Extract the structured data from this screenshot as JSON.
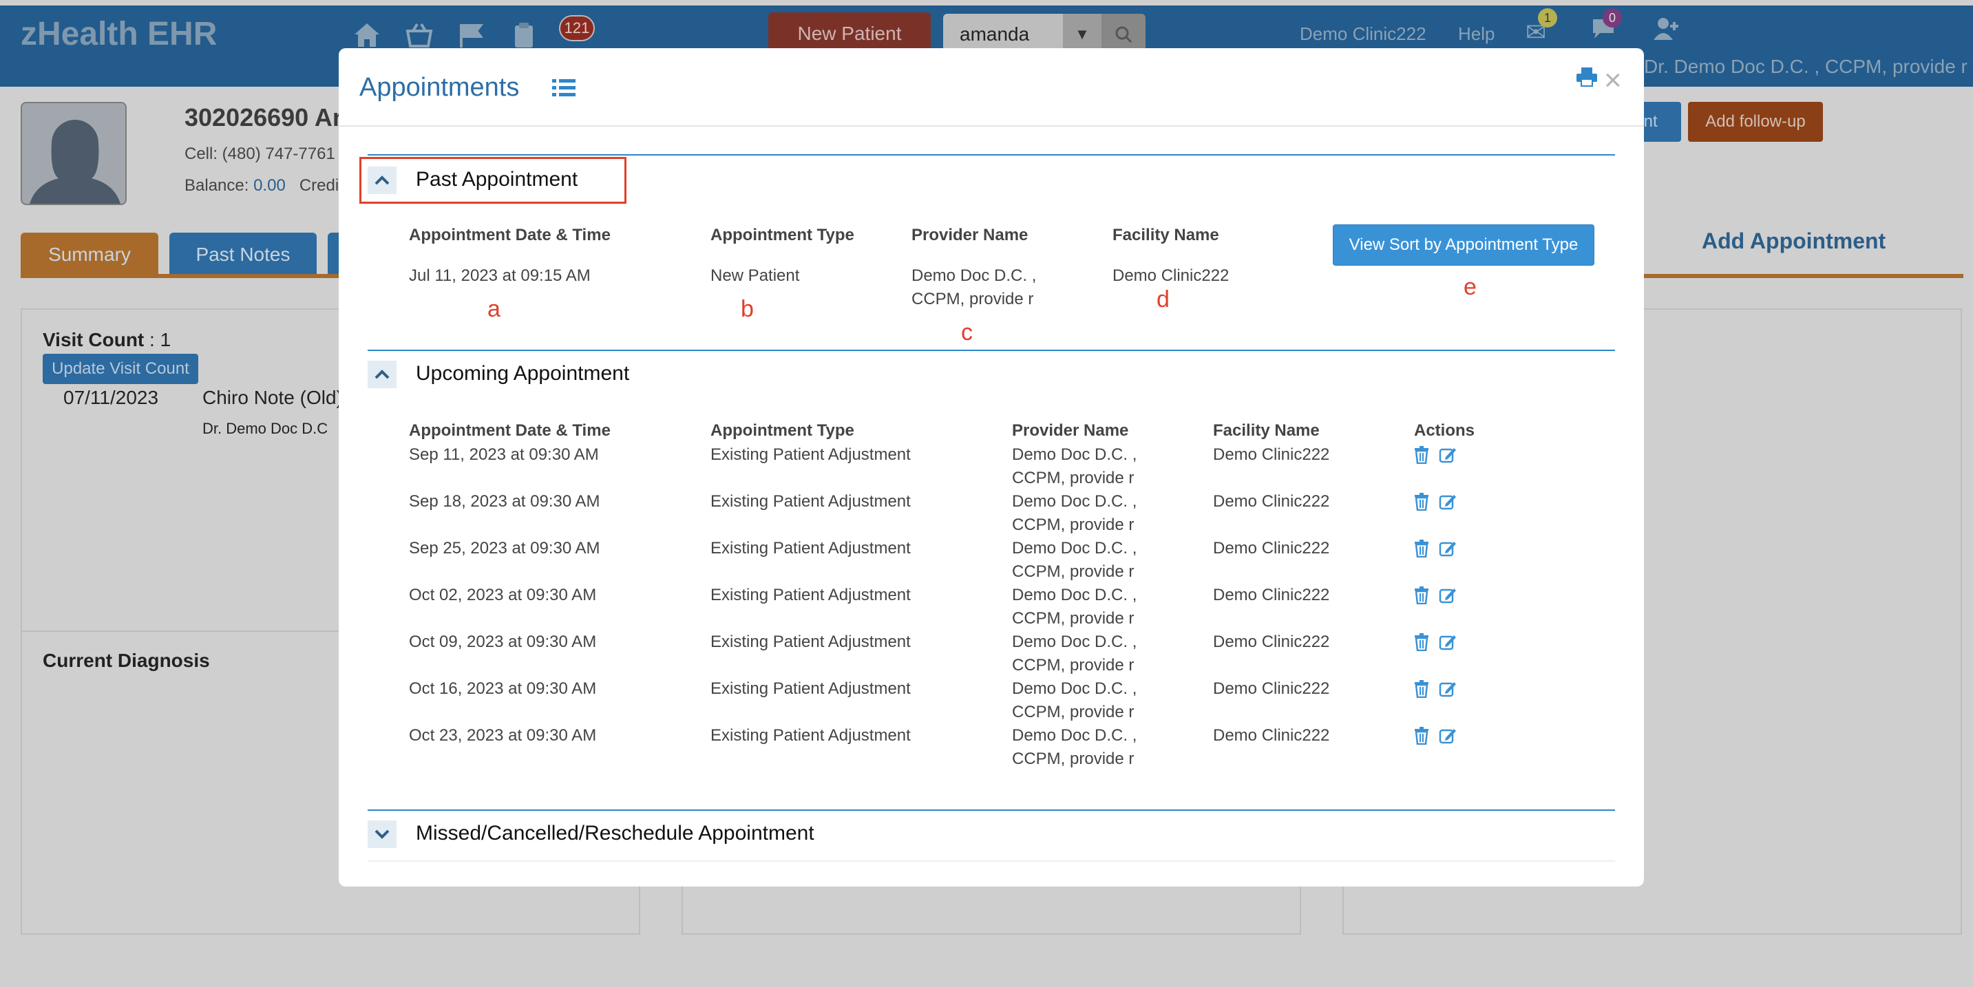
{
  "app": {
    "brand": "zHealth EHR",
    "notification_count": "121",
    "new_patient_label": "New Patient",
    "search_value": "amanda",
    "clinic": "Demo Clinic222",
    "help": "Help",
    "mail_count": "1",
    "chat_count": "0",
    "doctor": "Dr. Demo Doc D.C. , CCPM, provide r"
  },
  "patient": {
    "title": "302026690 Ar",
    "cell": "Cell: (480) 747-7761",
    "balance_label": "Balance:",
    "balance_value": "0.00",
    "credit_label": "Credi"
  },
  "tabs": [
    {
      "label": "Summary"
    },
    {
      "label": "Past Notes"
    }
  ],
  "right_actions": {
    "partial_btn": "ent",
    "follow_up": "Add follow-up",
    "add_appointment": "Add Appointment"
  },
  "summary_panel": {
    "visit_count_label": "Visit Count",
    "visit_count_value": ": 1",
    "update_btn": "Update Visit Count",
    "visit_date": "07/11/2023",
    "visit_note": "Chiro Note (Old)",
    "visit_doc": "Dr. Demo Doc D.C"
  },
  "diagnosis_panel": {
    "title": "Current Diagnosis"
  },
  "modal": {
    "title": "Appointments",
    "past": {
      "title": "Past Appointment",
      "headers": [
        "Appointment Date & Time",
        "Appointment Type",
        "Provider Name",
        "Facility Name"
      ],
      "row": {
        "date": "Jul 11, 2023 at 09:15 AM",
        "type": "New Patient",
        "provider1": "Demo Doc D.C. ,",
        "provider2": "CCPM, provide r",
        "facility": "Demo Clinic222"
      },
      "sort_btn": "View Sort by Appointment Type",
      "annotations": [
        "a",
        "b",
        "c",
        "d",
        "e"
      ]
    },
    "upcoming": {
      "title": "Upcoming Appointment",
      "headers": [
        "Appointment Date & Time",
        "Appointment Type",
        "Provider Name",
        "Facility Name",
        "Actions"
      ],
      "rows": [
        {
          "date": "Sep 11, 2023 at 09:30 AM",
          "type": "Existing Patient Adjustment",
          "provider1": "Demo Doc D.C. ,",
          "provider2": "CCPM, provide r",
          "facility": "Demo Clinic222"
        },
        {
          "date": "Sep 18, 2023 at 09:30 AM",
          "type": "Existing Patient Adjustment",
          "provider1": "Demo Doc D.C. ,",
          "provider2": "CCPM, provide r",
          "facility": "Demo Clinic222"
        },
        {
          "date": "Sep 25, 2023 at 09:30 AM",
          "type": "Existing Patient Adjustment",
          "provider1": "Demo Doc D.C. ,",
          "provider2": "CCPM, provide r",
          "facility": "Demo Clinic222"
        },
        {
          "date": "Oct 02, 2023 at 09:30 AM",
          "type": "Existing Patient Adjustment",
          "provider1": "Demo Doc D.C. ,",
          "provider2": "CCPM, provide r",
          "facility": "Demo Clinic222"
        },
        {
          "date": "Oct 09, 2023 at 09:30 AM",
          "type": "Existing Patient Adjustment",
          "provider1": "Demo Doc D.C. ,",
          "provider2": "CCPM, provide r",
          "facility": "Demo Clinic222"
        },
        {
          "date": "Oct 16, 2023 at 09:30 AM",
          "type": "Existing Patient Adjustment",
          "provider1": "Demo Doc D.C. ,",
          "provider2": "CCPM, provide r",
          "facility": "Demo Clinic222"
        },
        {
          "date": "Oct 23, 2023 at 09:30 AM",
          "type": "Existing Patient Adjustment",
          "provider1": "Demo Doc D.C. ,",
          "provider2": "CCPM, provide r",
          "facility": "Demo Clinic222"
        }
      ]
    },
    "missed": {
      "title": "Missed/Cancelled/Reschedule Appointment"
    }
  },
  "colors": {
    "header_bg": "#235b8c",
    "accent_blue": "#2e86c9",
    "annotation_red": "#e0402a",
    "follow_up_orange": "#a8501f"
  }
}
